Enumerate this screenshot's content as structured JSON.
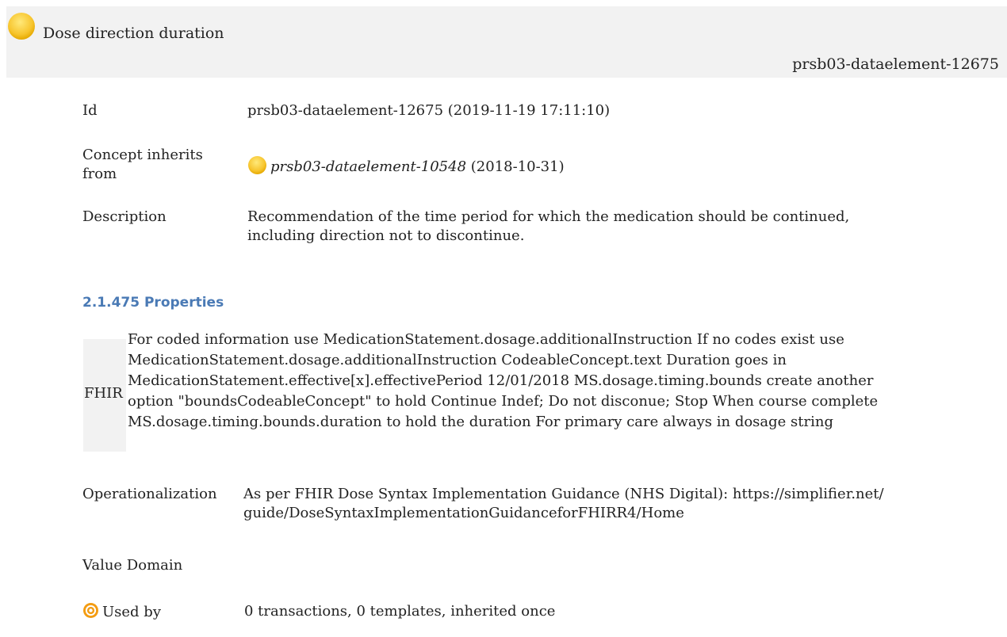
{
  "header": {
    "title": "Dose direction duration",
    "element_id": "prsb03-dataelement-12675",
    "status_icon": "yellow-circle-icon",
    "status_color": "#f7c52e"
  },
  "fields": {
    "id": {
      "label": "Id",
      "value": "prsb03-dataelement-12675 (2019-11-19 17:11:10)"
    },
    "concept_inherits": {
      "label_line1": "Concept inherits",
      "label_line2": "from",
      "ref_id": "prsb03-dataelement-10548",
      "ref_date": "(2018-10-31)",
      "status_icon": "yellow-circle-icon"
    },
    "description": {
      "label": "Description",
      "line1": "Recommendation of the time period for which the medication should be continued,",
      "line2": "including direction not to discontinue."
    }
  },
  "properties": {
    "heading": "2.1.475 Properties",
    "fhir_label": "FHIR",
    "fhir_lines": [
      "For coded information use MedicationStatement.dosage.additionalInstruction If no codes exist use",
      "MedicationStatement.dosage.additionalInstruction CodeableConcept.text Duration goes in",
      "MedicationStatement.effective[x].effectivePeriod 12/01/2018 MS.dosage.timing.bounds create another",
      "option \"boundsCodeableConcept\" to hold Continue Indef; Do not disconue; Stop When course complete",
      "MS.dosage.timing.bounds.duration to hold the duration For primary care always in dosage string"
    ]
  },
  "operationalization": {
    "label": "Operationalization",
    "line1": "As per FHIR Dose Syntax Implementation Guidance (NHS Digital): https://simplifier.net/",
    "line2": "guide/DoseSyntaxImplementationGuidanceforFHIRR4/Home"
  },
  "value_domain": {
    "label": "Value Domain"
  },
  "used_by": {
    "icon": "target-icon",
    "label": "Used by",
    "value": "0 transactions, 0 templates, inherited once",
    "icon_color": "#f39c12"
  }
}
